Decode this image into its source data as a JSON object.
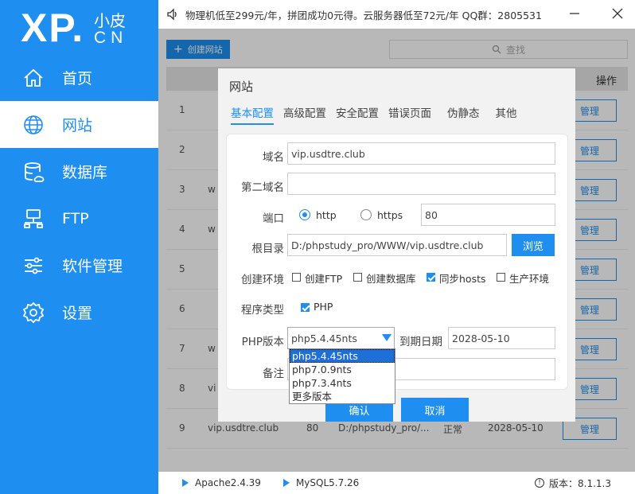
{
  "logo": {
    "mark": "XP.",
    "small": "小皮",
    "cn": "CN"
  },
  "nav": [
    {
      "label": "首页",
      "icon": "home-icon"
    },
    {
      "label": "网站",
      "icon": "globe-icon"
    },
    {
      "label": "数据库",
      "icon": "database-icon"
    },
    {
      "label": "FTP",
      "icon": "ftp-icon"
    },
    {
      "label": "软件管理",
      "icon": "sliders-icon"
    },
    {
      "label": "设置",
      "icon": "gear-icon"
    }
  ],
  "topbar": {
    "notice": "物理机低至299元/年，拼团成功0元得。云服务器低至72元/年 QQ群：2805531"
  },
  "main": {
    "create_label": "创建网站",
    "search_placeholder": "查找",
    "op_header": "操作",
    "manage_label": "管理",
    "rows": [
      {
        "num": "1",
        "pre": ""
      },
      {
        "num": "2",
        "pre": ""
      },
      {
        "num": "3",
        "pre": "w"
      },
      {
        "num": "4",
        "pre": "w"
      },
      {
        "num": "5",
        "pre": ""
      },
      {
        "num": "6",
        "pre": ""
      },
      {
        "num": "7",
        "pre": "w"
      },
      {
        "num": "8",
        "pre": "vi"
      },
      {
        "num": "9",
        "pre": "vip.usdtre.club",
        "mid1": "80",
        "mid2": "D:/phpstudy_pro/...",
        "mid3": "正常",
        "mid4": "2028-05-10"
      }
    ]
  },
  "status": {
    "apache": "Apache2.4.39",
    "mysql": "MySQL5.7.26",
    "version": "版本：8.1.1.3"
  },
  "dialog": {
    "title": "网站",
    "tabs": [
      "基本配置",
      "高级配置",
      "安全配置",
      "错误页面",
      "伪静态",
      "其他"
    ],
    "domain_label": "域名",
    "domain_value": "vip.usdtre.club",
    "second_domain_label": "第二域名",
    "second_domain_value": "",
    "port_label": "端口",
    "http_label": "http",
    "https_label": "https",
    "port_value": "80",
    "root_label": "根目录",
    "root_value": "D:/phpstudy_pro/WWW/vip.usdtre.club",
    "browse_label": "浏览",
    "env_label": "创建环境",
    "env_options": [
      {
        "label": "创建FTP",
        "checked": false
      },
      {
        "label": "创建数据库",
        "checked": false
      },
      {
        "label": "同步hosts",
        "checked": true
      },
      {
        "label": "生产环境",
        "checked": false
      }
    ],
    "prog_label": "程序类型",
    "prog_option": "PHP",
    "php_label": "PHP版本",
    "php_value": "php5.4.45nts",
    "expire_label": "到期日期",
    "expire_value": "2028-05-10",
    "note_label": "备注",
    "php_options": [
      "php5.4.45nts",
      "php7.0.9nts",
      "php7.3.4nts",
      "更多版本"
    ],
    "ok_label": "确认",
    "cancel_label": "取消"
  },
  "colors": {
    "accent": "#1e8ff0"
  }
}
